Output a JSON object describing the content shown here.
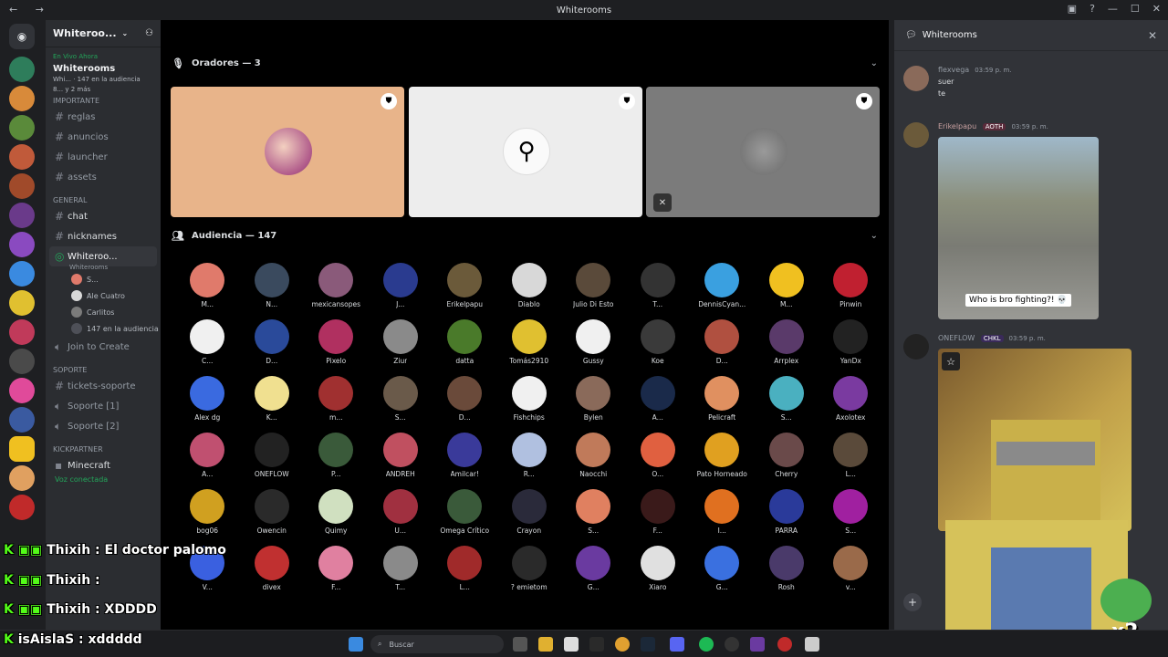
{
  "window": {
    "title": "Whiterooms"
  },
  "server": {
    "name": "Whiteroo...",
    "live_label": "En Vivo Ahora",
    "live_title": "Whiterooms",
    "live_sub": "Whi... · 147 en la audiencia",
    "live_more": "8... y 2 más",
    "categories": [
      {
        "name": "IMPORTANTE",
        "channels": [
          "reglas",
          "anuncios",
          "launcher",
          "assets"
        ]
      },
      {
        "name": "GENERAL",
        "channels": [
          "chat",
          "nicknames"
        ]
      }
    ],
    "stage_channel": {
      "name": "Whiteroo...",
      "sub": "Whiterooms"
    },
    "voice_members": [
      "S...",
      "Ale Cuatro",
      "Carlitos",
      "147 en la audiencia"
    ],
    "join_create": "Join to Create",
    "support": {
      "name": "SOPORTE",
      "channels": [
        "tickets-soporte",
        "Soporte [1]",
        "Soporte [2]"
      ]
    },
    "kickpartner": "KICKPARTNER",
    "minecraft": "Minecraft",
    "voice_status": "Voz conectada"
  },
  "stage": {
    "speakers_label": "Oradores — 3",
    "audience_label": "Audiencia — 147",
    "speaker_colors": [
      "#e8b48a",
      "#ededed",
      "#7b7b7b"
    ],
    "audience": [
      "M...",
      "N...",
      "mexicansopes",
      "J...",
      "Erikelpapu",
      "Diablo",
      "Julio Di Esto",
      "T...",
      "DennisCyan...",
      "M...",
      "Pinwin",
      "C...",
      "D...",
      "Pixelo",
      "Ziur",
      "datta",
      "Tomás2910",
      "Gussy",
      "Koe",
      "D...",
      "Arrplex",
      "YanDx",
      "Alex dg",
      "K...",
      "m...",
      "S...",
      "D...",
      "Fishchips",
      "Bylen",
      "A...",
      "Pelicraft",
      "S...",
      "Axolotex",
      "A...",
      "ONEFLOW",
      "P...",
      "ANDREH",
      "Amilcar!",
      "R...",
      "Naocchi",
      "O...",
      "Pato Horneado",
      "Cherry",
      "L...",
      "bog06",
      "Owencin",
      "Quimy",
      "U...",
      "Omega Crítico",
      "Crayon",
      "S...",
      "F...",
      "I...",
      "PARRA",
      "S...",
      "V...",
      "divex",
      "F...",
      "T...",
      "L...",
      "? emietom",
      "G...",
      "Xiaro",
      "G...",
      "Rosh",
      "v..."
    ],
    "audience_colors": [
      "#e07a6b",
      "#3a4a5e",
      "#8a5a7a",
      "#2a3b8f",
      "#6b5a3a",
      "#d8d8d8",
      "#5a4a3a",
      "#333333",
      "#3aa0e0",
      "#f0c020",
      "#c02030",
      "#f0f0f0",
      "#2a4a9a",
      "#b03060",
      "#8a8a8a",
      "#4a7a2a",
      "#e0c030",
      "#f0f0f0",
      "#3a3a3a",
      "#b05040",
      "#5a3a6a",
      "#222222",
      "#3a6ae0",
      "#f0e090",
      "#a03030",
      "#6a5a4a",
      "#6a4a3a",
      "#f0f0f0",
      "#8a6a5a",
      "#1a2a4a",
      "#e09060",
      "#4ab0c0",
      "#7a3aa0",
      "#c05070",
      "#222222",
      "#3a5a3a",
      "#c05060",
      "#3a3a9a",
      "#b0c0e0",
      "#c07a5a",
      "#e06040",
      "#e0a020",
      "#6a4a4a",
      "#5a4a3a",
      "#d0a020",
      "#2a2a2a",
      "#d0e0c0",
      "#a03040",
      "#3a5a3a",
      "#2a2a3a",
      "#e08060",
      "#3a1a1a",
      "#e07020",
      "#2a3a9a",
      "#a020a0",
      "#3a60e0",
      "#c03030",
      "#e080a0",
      "#8a8a8a",
      "#a02a2a",
      "#2a2a2a",
      "#6a3aa0",
      "#e0e0e0",
      "#3a70e0",
      "#4a3a6a",
      "#9a6a4a"
    ]
  },
  "chat": {
    "title": "Whiterooms",
    "messages": [
      {
        "user": "flexvega",
        "time": "03:59 p. m.",
        "lines": [
          "suer",
          "te"
        ]
      },
      {
        "user": "Erikelpapu",
        "badge": "AOTH",
        "time": "03:59 p. m.",
        "caption": "Who is bro fighting?! 💀"
      },
      {
        "user": "ONEFLOW",
        "badge": "CHKL",
        "time": "03:59 p. m."
      }
    ]
  },
  "taskbar": {
    "search": "Buscar"
  },
  "overlay": {
    "lines": [
      "Thixih : El doctor palomo",
      "Thixih :",
      "Thixih : XDDDD",
      "isAislaS : xddddd"
    ],
    "multiplier": "x2"
  }
}
